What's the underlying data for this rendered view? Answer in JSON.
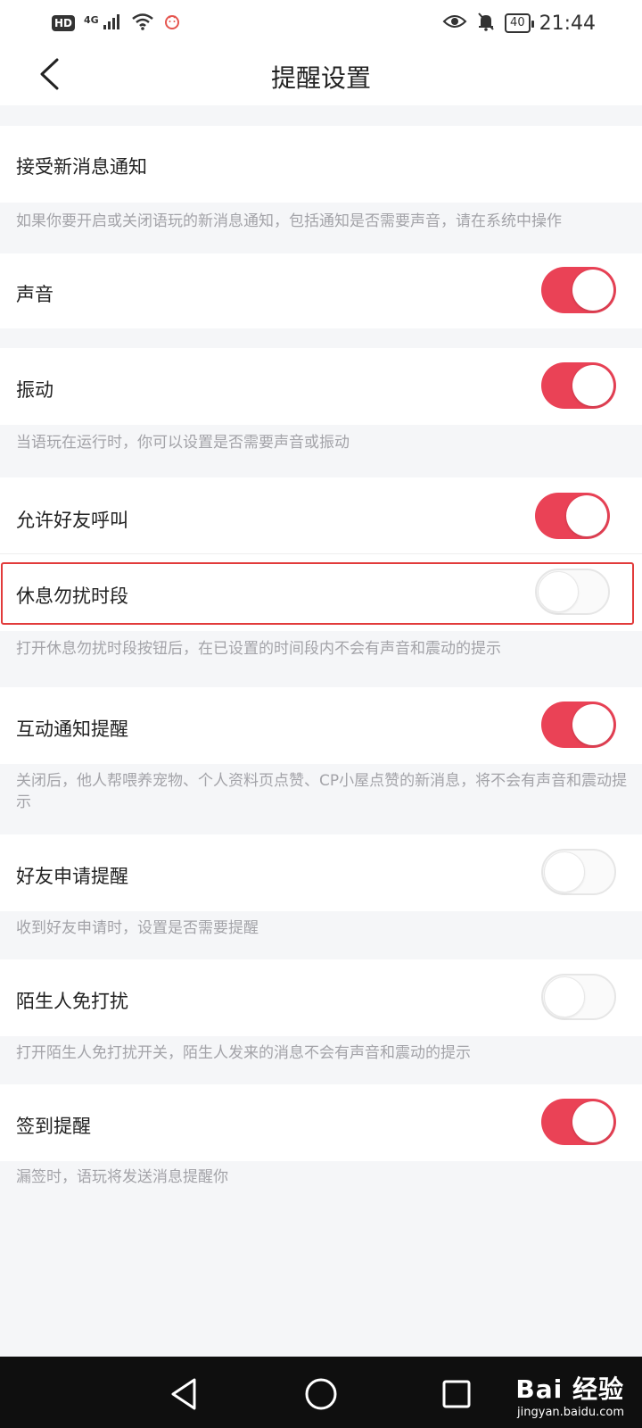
{
  "status_bar": {
    "hd": "HD",
    "network": "4G",
    "battery": "40",
    "time": "21:44",
    "icons": [
      "signal-icon",
      "wifi-icon",
      "app-notification-icon",
      "eye-icon",
      "bell-muted-icon",
      "battery-icon"
    ]
  },
  "header": {
    "title": "提醒设置",
    "back_icon": "chevron-left-icon"
  },
  "settings": {
    "new_message": {
      "label": "接受新消息通知",
      "desc": "如果你要开启或关闭语玩的新消息通知，包括通知是否需要声音，请在系统中操作"
    },
    "sound": {
      "label": "声音",
      "enabled": true
    },
    "vibration": {
      "label": "振动",
      "enabled": true,
      "desc": "当语玩在运行时，你可以设置是否需要声音或振动"
    },
    "friend_call": {
      "label": "允许好友呼叫",
      "enabled": true
    },
    "do_not_disturb": {
      "label": "休息勿扰时段",
      "enabled": false,
      "desc": "打开休息勿扰时段按钮后，在已设置的时间段内不会有声音和震动的提示"
    },
    "interaction": {
      "label": "互动通知提醒",
      "enabled": true,
      "desc": "关闭后，他人帮喂养宠物、个人资料页点赞、CP小屋点赞的新消息，将不会有声音和震动提示"
    },
    "friend_request": {
      "label": "好友申请提醒",
      "enabled": false,
      "desc": "收到好友申请时，设置是否需要提醒"
    },
    "stranger": {
      "label": "陌生人免打扰",
      "enabled": false,
      "desc": "打开陌生人免打扰开关，陌生人发来的消息不会有声音和震动的提示"
    },
    "checkin": {
      "label": "签到提醒",
      "enabled": true,
      "desc": "漏签时，语玩将发送消息提醒你"
    }
  },
  "colors": {
    "accent": "#ea4256",
    "highlight_border": "#e23b3b",
    "background": "#f5f6f8",
    "description_text": "#a3a3a8"
  },
  "nav_bar": {
    "icons": [
      "back-triangle-icon",
      "home-circle-icon",
      "recents-square-icon"
    ]
  },
  "watermark": {
    "logo": "Bai 经验",
    "url": "jingyan.baidu.com"
  }
}
